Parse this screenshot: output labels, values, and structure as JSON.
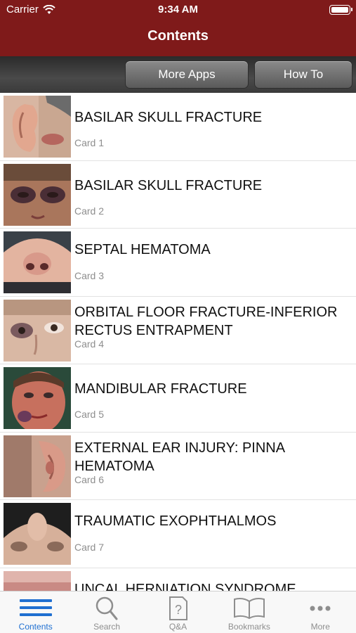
{
  "status_bar": {
    "carrier": "Carrier",
    "time": "9:34 AM"
  },
  "nav": {
    "title": "Contents"
  },
  "toolbar": {
    "more_apps": "More Apps",
    "how_to": "How To"
  },
  "items": [
    {
      "title": "BASILAR SKULL FRACTURE",
      "card": "Card 1"
    },
    {
      "title": "BASILAR SKULL FRACTURE",
      "card": "Card 2"
    },
    {
      "title": "SEPTAL HEMATOMA",
      "card": "Card 3"
    },
    {
      "title": "ORBITAL FLOOR FRACTURE-INFERIOR RECTUS ENTRAPMENT",
      "card": "Card 4"
    },
    {
      "title": "MANDIBULAR FRACTURE",
      "card": "Card 5"
    },
    {
      "title": "EXTERNAL EAR INJURY: PINNA HEMATOMA",
      "card": "Card 6"
    },
    {
      "title": "TRAUMATIC EXOPHTHALMOS",
      "card": "Card 7"
    },
    {
      "title": "UNCAL HERNIATION SYNDROME",
      "card": ""
    }
  ],
  "tabs": [
    {
      "label": "Contents",
      "icon": "list-icon",
      "active": true
    },
    {
      "label": "Search",
      "icon": "search-icon",
      "active": false
    },
    {
      "label": "Q&A",
      "icon": "question-icon",
      "active": false
    },
    {
      "label": "Bookmarks",
      "icon": "book-icon",
      "active": false
    },
    {
      "label": "More",
      "icon": "more-icon",
      "active": false
    }
  ],
  "colors": {
    "nav_bg": "#7f1a1a",
    "tab_active": "#1f6fd1",
    "tab_inactive": "#8e8e8e"
  }
}
